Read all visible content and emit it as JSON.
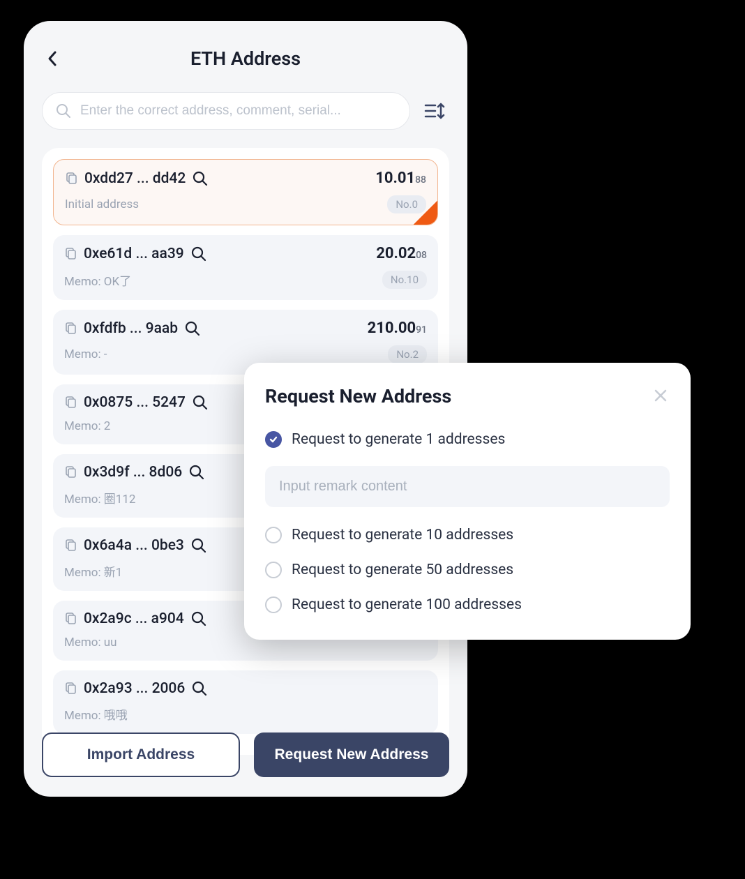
{
  "header": {
    "title": "ETH Address"
  },
  "search": {
    "placeholder": "Enter the correct address, comment, serial..."
  },
  "list": [
    {
      "address": "0xdd27 ... dd42",
      "balance": "10.01",
      "balance_sub": "88",
      "memo": "Initial address",
      "badge": "No.0",
      "selected": true
    },
    {
      "address": "0xe61d ... aa39",
      "balance": "20.02",
      "balance_sub": "08",
      "memo": "Memo: OK了",
      "badge": "No.10",
      "selected": false
    },
    {
      "address": "0xfdfb ... 9aab",
      "balance": "210.00",
      "balance_sub": "91",
      "memo": "Memo: -",
      "badge": "No.2",
      "selected": false
    },
    {
      "address": "0x0875 ... 5247",
      "balance": "",
      "balance_sub": "",
      "memo": "Memo: 2",
      "badge": "",
      "selected": false
    },
    {
      "address": "0x3d9f ... 8d06",
      "balance": "",
      "balance_sub": "",
      "memo": "Memo: 圈112",
      "badge": "",
      "selected": false
    },
    {
      "address": "0x6a4a ... 0be3",
      "balance": "",
      "balance_sub": "",
      "memo": "Memo: 新1",
      "badge": "",
      "selected": false
    },
    {
      "address": "0x2a9c ... a904",
      "balance": "",
      "balance_sub": "",
      "memo": "Memo: uu",
      "badge": "",
      "selected": false
    },
    {
      "address": "0x2a93 ... 2006",
      "balance": "",
      "balance_sub": "",
      "memo": "Memo: 哦哦",
      "badge": "",
      "selected": false
    }
  ],
  "footer": {
    "import_label": "Import Address",
    "request_label": "Request New Address"
  },
  "modal": {
    "title": "Request New Address",
    "remark_placeholder": "Input remark content",
    "options": [
      {
        "label": "Request to generate 1 addresses",
        "checked": true
      },
      {
        "label": "Request to generate 10 addresses",
        "checked": false
      },
      {
        "label": "Request to generate 50 addresses",
        "checked": false
      },
      {
        "label": "Request to generate 100 addresses",
        "checked": false
      }
    ]
  }
}
